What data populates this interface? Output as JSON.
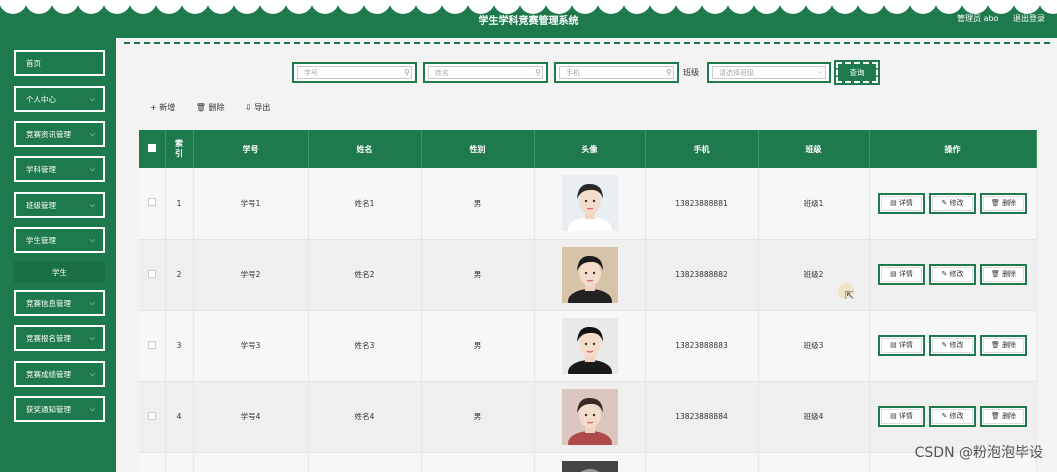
{
  "header": {
    "title": "学生学科竞赛管理系统",
    "user": "管理员 abo",
    "logout": "退出登录"
  },
  "sidebar": {
    "items": [
      {
        "label": "首页",
        "chevron": false
      },
      {
        "label": "个人中心",
        "chevron": true
      },
      {
        "label": "竞赛资讯管理",
        "chevron": true
      },
      {
        "label": "学科管理",
        "chevron": true
      },
      {
        "label": "班级管理",
        "chevron": true
      },
      {
        "label": "学生管理",
        "chevron": true
      },
      {
        "label": "竞赛信息管理",
        "chevron": true
      },
      {
        "label": "竞赛报名管理",
        "chevron": true
      },
      {
        "label": "竞赛成绩管理",
        "chevron": true
      },
      {
        "label": "获奖通知管理",
        "chevron": true
      }
    ],
    "sub_item": "学生"
  },
  "search": {
    "student_no_placeholder": "学号",
    "name_placeholder": "姓名",
    "phone_placeholder": "手机",
    "class_label": "班级",
    "class_placeholder": "请选择班级",
    "query_button": "查询"
  },
  "toolbar": {
    "add": "+ 新增",
    "delete": "🗑 删除",
    "export": "⇩ 导出"
  },
  "table": {
    "headers": [
      "索引",
      "学号",
      "姓名",
      "性别",
      "头像",
      "手机",
      "班级",
      "操作"
    ],
    "rows": [
      {
        "index": "1",
        "student_no": "学号1",
        "name": "姓名1",
        "gender": "男",
        "phone": "13823888881",
        "class": "班级1"
      },
      {
        "index": "2",
        "student_no": "学号2",
        "name": "姓名2",
        "gender": "男",
        "phone": "13823888882",
        "class": "班级2"
      },
      {
        "index": "3",
        "student_no": "学号3",
        "name": "姓名3",
        "gender": "男",
        "phone": "13823888883",
        "class": "班级3"
      },
      {
        "index": "4",
        "student_no": "学号4",
        "name": "姓名4",
        "gender": "男",
        "phone": "13823888884",
        "class": "班级4"
      }
    ],
    "ops": {
      "detail": "详情",
      "edit": "修改",
      "delete": "删除"
    }
  },
  "watermark": "CSDN @粉泡泡毕设",
  "colors": {
    "primary": "#1e7a4d",
    "sidebar": "#1e7a4d"
  },
  "icons": [
    "search-icon",
    "chevron-down-icon",
    "detail-icon",
    "edit-icon",
    "trash-icon",
    "cursor-icon"
  ]
}
